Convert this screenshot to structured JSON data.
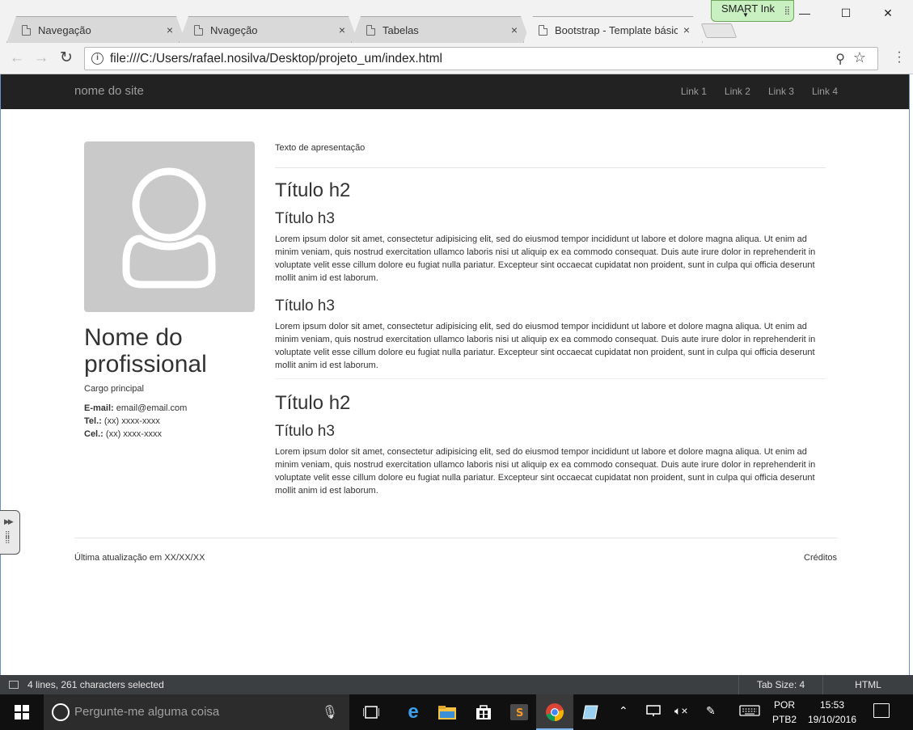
{
  "browser": {
    "tabs": [
      {
        "label": "Navegação",
        "close": "×"
      },
      {
        "label": "Nvageção",
        "close": "×"
      },
      {
        "label": "Tabelas",
        "close": "×"
      },
      {
        "label": "Bootstrap - Template básico",
        "close": "×"
      }
    ],
    "url": "file:///C:/Users/rafael.nosilva/Desktop/projeto_um/index.html",
    "smart_ink_label": "SMART Ink",
    "window_buttons": {
      "minimize": "—",
      "maximize": "☐",
      "close": "✕"
    }
  },
  "site": {
    "brand": "nome do site",
    "nav_links": [
      "Link 1",
      "Link 2",
      "Link 3",
      "Link 4"
    ]
  },
  "profile": {
    "name": "Nome do profissional",
    "role": "Cargo principal",
    "email_label": "E-mail:",
    "email": "email@email.com",
    "tel_label": "Tel.:",
    "tel": "(xx) xxxx-xxxx",
    "cel_label": "Cel.:",
    "cel": "(xx) xxxx-xxxx"
  },
  "main": {
    "intro": "Texto de apresentação",
    "sections": [
      {
        "h2": "Título h2",
        "blocks": [
          {
            "h3": "Título h3",
            "p": "Lorem ipsum dolor sit amet, consectetur adipisicing elit, sed do eiusmod tempor incididunt ut labore et dolore magna aliqua. Ut enim ad minim veniam, quis nostrud exercitation ullamco laboris nisi ut aliquip ex ea commodo consequat. Duis aute irure dolor in reprehenderit in voluptate velit esse cillum dolore eu fugiat nulla pariatur. Excepteur sint occaecat cupidatat non proident, sunt in culpa qui officia deserunt mollit anim id est laborum."
          },
          {
            "h3": "Título h3",
            "p": "Lorem ipsum dolor sit amet, consectetur adipisicing elit, sed do eiusmod tempor incididunt ut labore et dolore magna aliqua. Ut enim ad minim veniam, quis nostrud exercitation ullamco laboris nisi ut aliquip ex ea commodo consequat. Duis aute irure dolor in reprehenderit in voluptate velit esse cillum dolore eu fugiat nulla pariatur. Excepteur sint occaecat cupidatat non proident, sunt in culpa qui officia deserunt mollit anim id est laborum."
          }
        ]
      },
      {
        "h2": "Título h2",
        "blocks": [
          {
            "h3": "Título h3",
            "p": "Lorem ipsum dolor sit amet, consectetur adipisicing elit, sed do eiusmod tempor incididunt ut labore et dolore magna aliqua. Ut enim ad minim veniam, quis nostrud exercitation ullamco laboris nisi ut aliquip ex ea commodo consequat. Duis aute irure dolor in reprehenderit in voluptate velit esse cillum dolore eu fugiat nulla pariatur. Excepteur sint occaecat cupidatat non proident, sunt in culpa qui officia deserunt mollit anim id est laborum."
          }
        ]
      }
    ]
  },
  "footer": {
    "updated": "Última atualização em XX/XX/XX",
    "credits": "Créditos"
  },
  "editor_status": {
    "selection": "4 lines, 261 characters selected",
    "tab_size": "Tab Size: 4",
    "syntax": "HTML"
  },
  "taskbar": {
    "search_placeholder": "Pergunte-me alguma coisa",
    "language": "POR",
    "keyboard": "PTB2",
    "time": "15:53",
    "date": "19/10/2016"
  },
  "colors": {
    "navbar_bg": "#222222",
    "navbar_text": "#9d9d9d",
    "avatar_bg": "#c9c9c9",
    "taskbar_bg": "#101010",
    "status_bg": "#3c3f41",
    "smart_ink_bg": "#c8f0c0"
  },
  "icons": [
    "document-icon",
    "close-icon",
    "back-arrow-icon",
    "forward-arrow-icon",
    "reload-icon",
    "info-icon",
    "zoom-icon",
    "bookmark-star-icon",
    "menu-dots-icon",
    "user-avatar-icon",
    "windows-start-icon",
    "cortana-icon",
    "microphone-icon",
    "task-view-icon",
    "edge-icon",
    "file-explorer-icon",
    "store-icon",
    "sublime-text-icon",
    "chrome-icon",
    "notepad-icon",
    "tray-chevron-icon",
    "network-icon",
    "volume-muted-icon",
    "pen-icon",
    "keyboard-icon",
    "notification-icon"
  ]
}
